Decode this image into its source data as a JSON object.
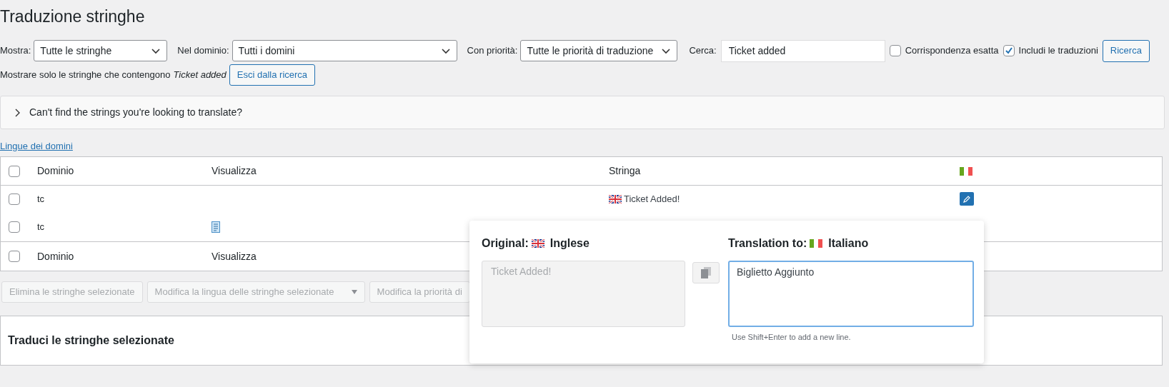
{
  "page_title": "Traduzione stringhe",
  "filters": [
    {
      "label": "Mostra:",
      "value": "Tutte le stringhe"
    },
    {
      "label": "Nel dominio:",
      "value": "Tutti i domini"
    },
    {
      "label": "Con priorità:",
      "value": "Tutte le priorità di traduzione"
    }
  ],
  "search": {
    "label": "Cerca:",
    "value": "Ticket added"
  },
  "options": [
    {
      "label": "Corrispondenza esatta",
      "checked": false
    },
    {
      "label": "Includi le traduzioni",
      "checked": true
    }
  ],
  "search_button": "Ricerca",
  "notice": {
    "text": "Mostrare solo le stringhe che contengono",
    "term": "Ticket added",
    "button": "Esci dalla ricerca"
  },
  "accordion": {
    "title": "Can't find the strings you're looking to translate?",
    "expanded": false
  },
  "link": "Lingue dei domini",
  "table": {
    "columns": [
      "Dominio",
      "Visualizza",
      "Stringa"
    ],
    "rows": [
      {
        "domain": "tc",
        "has_view": false,
        "string": "Ticket Added!",
        "checked": false
      },
      {
        "domain": "tc",
        "has_view": true,
        "string": "",
        "checked": false
      }
    ],
    "footer": [
      "Dominio",
      "Visualizza"
    ],
    "header_checked": false,
    "footer_checked": false
  },
  "bulk_actions": [
    {
      "label": "Elimina le stringhe selezionate",
      "kind": "button"
    },
    {
      "label": "Modifica la lingua delle stringhe selezionate",
      "kind": "select"
    },
    {
      "label": "Modifica la priorità di",
      "kind": "button"
    }
  ],
  "translate_panel": {
    "title": "Traduci le stringhe selezionate"
  },
  "popup": {
    "original_label": "Original:",
    "original_language": "Inglese",
    "original_text": "Ticket Added!",
    "translation_label": "Translation to:",
    "translation_language": "Italiano",
    "translation_text": "Biglietto Aggiunto",
    "hint": "Use Shift+Enter to add a new line."
  }
}
